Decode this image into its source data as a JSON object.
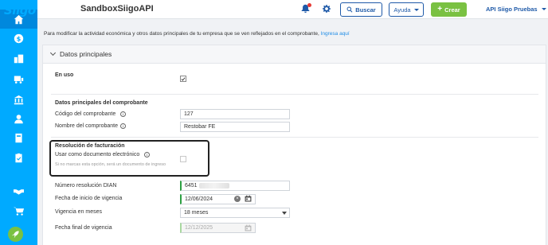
{
  "header": {
    "logo": "Siigo",
    "app_title": "SandboxSiigoAPI",
    "search_label": "Buscar",
    "help_label": "Ayuda",
    "create_label": "Crear",
    "user_label": "API Siigo Pruebas"
  },
  "intro": {
    "text": "Para modificar la actividad económica y otros datos principales de tu empresa que se ven reflejados en el comprobante, ",
    "link": "Ingresa aquí"
  },
  "panel": {
    "title": "Datos principales",
    "en_uso_label": "En uso",
    "en_uso_checked": true,
    "section_comprobante": "Datos principales del comprobante",
    "codigo_label": "Código del comprobante",
    "codigo_value": "127",
    "nombre_label": "Nombre del comprobante",
    "nombre_value": "Restobar FE",
    "section_resolucion": "Resolución de facturación",
    "usar_label": "Usar como documento electrónico",
    "usar_checked": false,
    "usar_hint": "Si no marcas esta opción, será un documento de ingreso",
    "resolucion_label": "Número resolución DIAN",
    "resolucion_value": "6451",
    "fecha_inicio_label": "Fecha de inicio de vigencia",
    "fecha_inicio_value": "12/06/2024",
    "vigencia_label": "Vigencia en meses",
    "vigencia_value": "18 meses",
    "fecha_final_label": "Fecha final de vigencia",
    "fecha_final_value": "12/12/2025"
  },
  "icons": {
    "sidebar": [
      "home-icon",
      "dollar-icon",
      "buildings-icon",
      "cart-icon",
      "bank-icon",
      "user-icon",
      "book-icon",
      "clipboard-icon",
      "handshake-icon",
      "shop-cart-icon",
      "rocket-icon"
    ]
  },
  "colors": {
    "sidebar": "#00aaff",
    "primary": "#1f5aa8",
    "create": "#7ac142",
    "link": "#1f8ce6"
  }
}
